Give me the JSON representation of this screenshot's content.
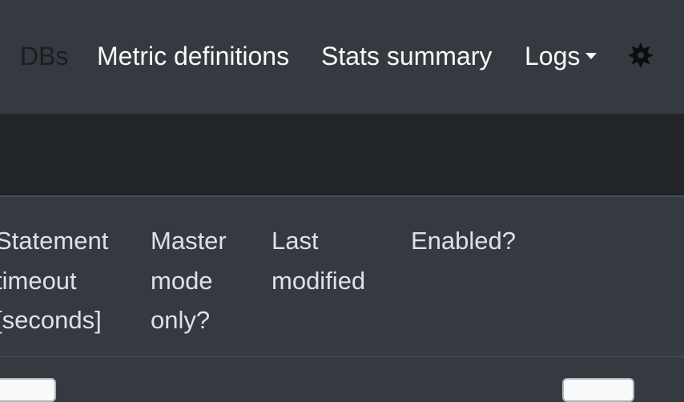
{
  "navbar": {
    "items": [
      {
        "label": "DBs"
      },
      {
        "label": "Metric definitions"
      },
      {
        "label": "Stats summary"
      },
      {
        "label": "Logs"
      }
    ],
    "theme_toggle_icon": "sun-icon"
  },
  "table": {
    "headers": [
      {
        "lines": [
          "Statement",
          "timeout",
          "[seconds]"
        ]
      },
      {
        "lines": [
          "Master",
          "mode",
          "only?"
        ]
      },
      {
        "lines": [
          "Last",
          "modified"
        ]
      },
      {
        "lines": [
          "Enabled?"
        ]
      }
    ]
  },
  "colors": {
    "navbar_bg": "#343a40",
    "band_bg": "#212529",
    "text_light": "#f8f9fa",
    "active_link": "#1a1d20"
  }
}
